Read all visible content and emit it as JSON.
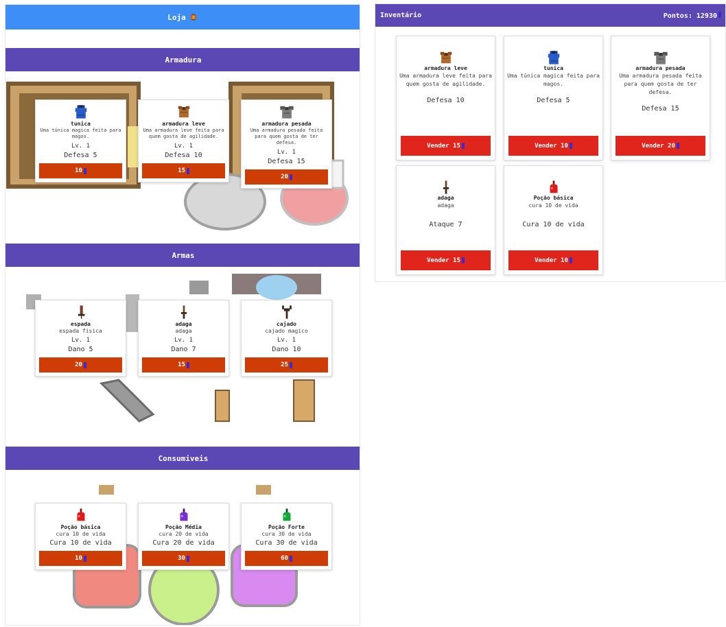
{
  "shop": {
    "title": "Loja",
    "sections": [
      {
        "title": "Armadura",
        "items": [
          {
            "icon": "tunic-icon",
            "name": "tunica",
            "desc": "Uma túnica magica feita para magos.",
            "level": "Lv. 1",
            "stat": "Defesa 5",
            "price": "10"
          },
          {
            "icon": "light-armor-icon",
            "name": "armadura leve",
            "desc": "Uma armadura leve feita para quem gosta de agilidade.",
            "level": "Lv. 1",
            "stat": "Defesa 10",
            "price": "15"
          },
          {
            "icon": "heavy-armor-icon",
            "name": "armadura pesada",
            "desc": "Uma armadura pesada feita para quem gosta de ter defesa.",
            "level": "Lv. 1",
            "stat": "Defesa 15",
            "price": "20"
          }
        ]
      },
      {
        "title": "Armas",
        "items": [
          {
            "icon": "sword-icon",
            "name": "espada",
            "desc": "espada fisica",
            "level": "Lv. 1",
            "stat": "Dano 5",
            "price": "20"
          },
          {
            "icon": "dagger-icon",
            "name": "adaga",
            "desc": "adaga",
            "level": "Lv. 1",
            "stat": "Dano 7",
            "price": "15"
          },
          {
            "icon": "staff-icon",
            "name": "cajado",
            "desc": "cajado magico",
            "level": "Lv. 1",
            "stat": "Dano 10",
            "price": "25"
          }
        ]
      },
      {
        "title": "Consumiveis",
        "items": [
          {
            "icon": "red-potion-icon",
            "name": "Poção básica",
            "desc": "cura 10 de vida",
            "level": "",
            "stat": "Cura 10 de vida",
            "price": "10"
          },
          {
            "icon": "purple-potion-icon",
            "name": "Poção Média",
            "desc": "cura 20 de vida",
            "level": "",
            "stat": "Cura 20 de vida",
            "price": "30"
          },
          {
            "icon": "green-potion-icon",
            "name": "Poção Forte",
            "desc": "cura 30 de vida",
            "level": "",
            "stat": "Cura 30 de vida",
            "price": "60"
          }
        ]
      }
    ]
  },
  "inventory": {
    "title": "Inventário",
    "points": "Pontos: 12930",
    "items": [
      {
        "icon": "light-armor-icon",
        "name": "armadura leve",
        "desc": "Uma armadura leve feita para quem gosta de agilidade.",
        "stat": "Defesa 10",
        "sell": "Vender 15"
      },
      {
        "icon": "tunic-icon",
        "name": "tunica",
        "desc": "Uma túnica magica feita para magos.",
        "stat": "Defesa 5",
        "sell": "Vender 10"
      },
      {
        "icon": "heavy-armor-icon",
        "name": "armadura pesada",
        "desc": "Uma armadura pesada feita para quem gosta de ter defesa.",
        "stat": "Defesa 15",
        "sell": "Vender 20"
      },
      {
        "icon": "dagger-icon",
        "name": "adaga",
        "desc": "adaga",
        "stat": "Ataque 7",
        "sell": "Vender 15"
      },
      {
        "icon": "red-potion-icon",
        "name": "Poção básica",
        "desc": "cura 10 de vida",
        "stat": "Cura 10 de vida",
        "sell": "Vender 10"
      }
    ]
  },
  "colors": {
    "shop_header": "#3e8ef7",
    "section_header": "#5c48b5",
    "buy_button": "#cf3d06",
    "sell_button": "#e0251c",
    "gem": "#3b2bcf"
  }
}
